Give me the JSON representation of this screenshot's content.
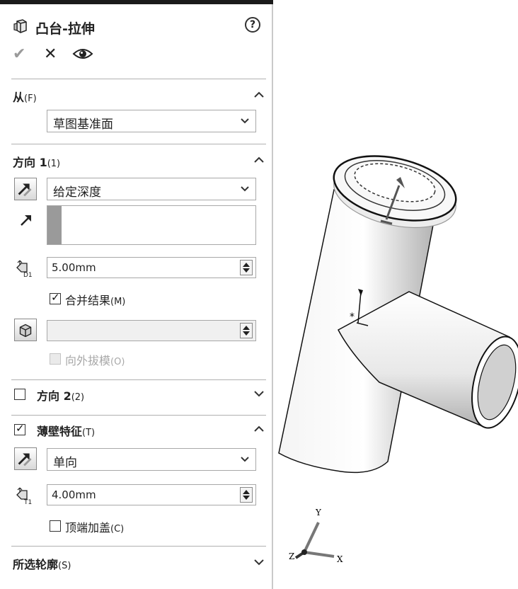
{
  "panel": {
    "title": "凸台-拉伸",
    "help_icon": "?",
    "ok_icon": "✔",
    "cancel_icon": "✕"
  },
  "from": {
    "title": "从",
    "title_key": "(F)",
    "value": "草图基准面"
  },
  "direction1": {
    "title": "方向 1",
    "title_key": "(1)",
    "end_condition": "给定深度",
    "depth": "5.00mm",
    "merge_result_label": "合并结果",
    "merge_result_key": "(M)",
    "merge_result_checked": true,
    "draft_value": "",
    "draft_outward_label": "向外拔模",
    "draft_outward_key": "(O)",
    "draft_outward_checked": false
  },
  "direction2": {
    "title": "方向 2",
    "title_key": "(2)",
    "checked": false
  },
  "thin_feature": {
    "title": "薄壁特征",
    "title_key": "(T)",
    "checked": true,
    "type": "单向",
    "thickness": "4.00mm",
    "cap_ends_label": "顶端加盖",
    "cap_ends_key": "(C)",
    "cap_ends_checked": false
  },
  "selected_contours": {
    "title": "所选轮廓",
    "title_key": "(S)"
  },
  "triad": {
    "x": "X",
    "y": "Y",
    "z": "Z"
  },
  "icons": {
    "title": "extrude-boss-icon",
    "ok": "check-icon",
    "cancel": "close-icon",
    "preview": "eye-icon",
    "help": "help-icon",
    "reverse": "reverse-direction-icon",
    "direction_vector": "direction-arrow-icon",
    "depth": "depth-dimension-icon",
    "draft": "draft-icon"
  }
}
